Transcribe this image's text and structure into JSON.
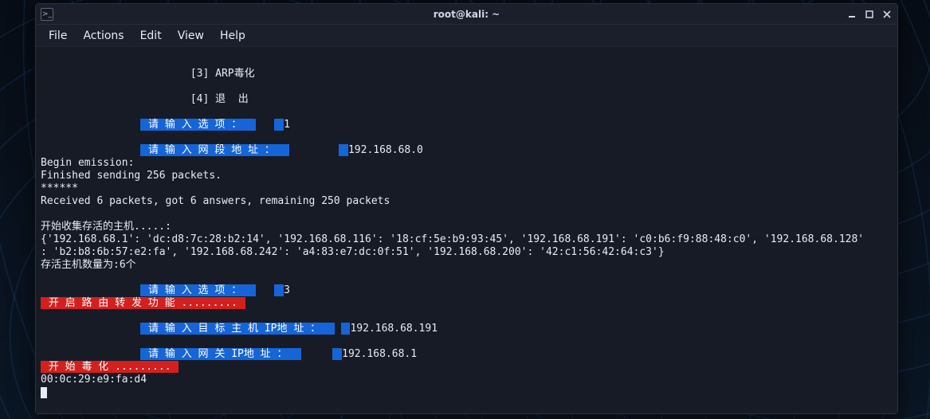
{
  "window": {
    "title": "root@kali: ~",
    "app_icon_glyph": ">_"
  },
  "menubar": {
    "items": [
      "File",
      "Actions",
      "Edit",
      "View",
      "Help"
    ]
  },
  "terminal": {
    "indent_menu": "                        ",
    "indent_prompt": "                ",
    "menu": {
      "opt3": "[3] ARP毒化",
      "opt4": "[4] 退  出"
    },
    "prompts": {
      "choose_option": " 请 输 入 选 项 ：  ",
      "enter_segment": " 请 输 入 网 段 地 址 ：  ",
      "enter_target_ip": " 请 输 入 目 标 主 机 IP地 址 ：  ",
      "enter_gateway_ip": " 请 输 入 网 关 IP地 址 ：  "
    },
    "inputs": {
      "option1": "1",
      "segment": "192.168.68.0",
      "option2": "3",
      "target_ip": "192.168.68.191",
      "gateway_ip": "192.168.68.1"
    },
    "banners": {
      "forward_enable": " 开 启 路 由 转 发 功 能 ......... ",
      "start_poison": " 开 始 毒 化 ......... "
    },
    "plain": {
      "begin": "Begin emission:",
      "finished": "Finished sending 256 packets.",
      "stars": "******",
      "received": "Received 6 packets, got 6 answers, remaining 250 packets",
      "collect_header": "开始收集存活的主机.....:",
      "hosts_dict_line1": "{'192.168.68.1': 'dc:d8:7c:28:b2:14', '192.168.68.116': '18:cf:5e:b9:93:45', '192.168.68.191': 'c0:b6:f9:88:48:c0', '192.168.68.128'",
      "hosts_dict_line2": ": 'b2:b8:6b:57:e2:fa', '192.168.68.242': 'a4:83:e7:dc:0f:51', '192.168.68.200': '42:c1:56:42:64:c3'}",
      "alive_count": "存活主机数量为:6个",
      "mac": "00:0c:29:e9:fa:d4"
    },
    "gap_small": "   ",
    "gap_med": "        "
  }
}
